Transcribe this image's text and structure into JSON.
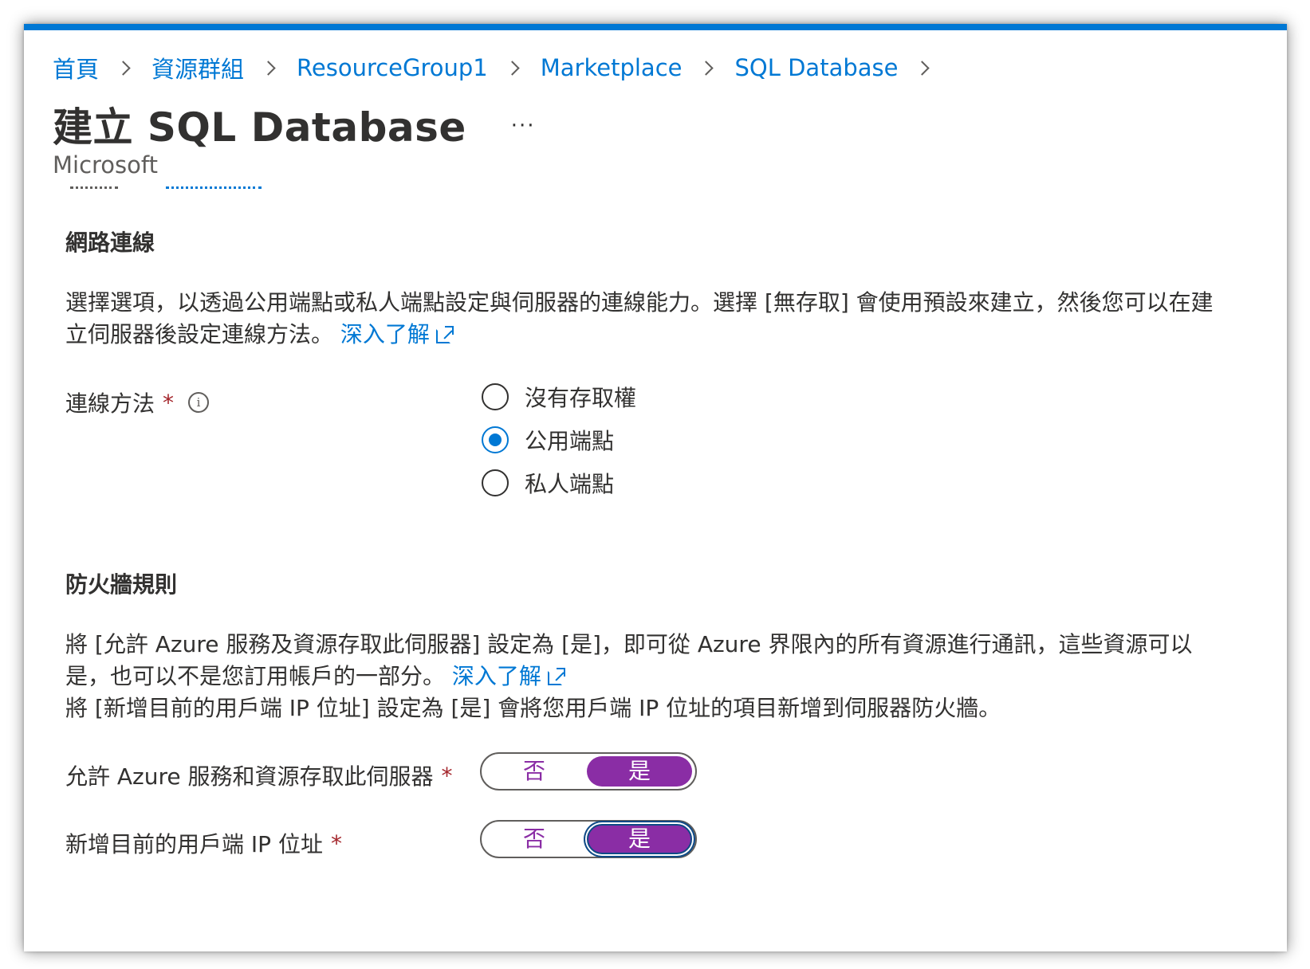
{
  "breadcrumb": {
    "items": [
      "首頁",
      "資源群組",
      "ResourceGroup1",
      "Marketplace",
      "SQL Database"
    ]
  },
  "header": {
    "title": "建立 SQL Database",
    "more_label": "···",
    "subtitle": "Microsoft"
  },
  "network": {
    "section_title": "網路連線",
    "description": "選擇選項，以透過公用端點或私人端點設定與伺服器的連線能力。選擇 [無存取] 會使用預設來建立，然後您可以在建立伺服器後設定連線方法。",
    "learn_more": "深入了解",
    "connection_method": {
      "label": "連線方法",
      "required_mark": "*",
      "info_icon": "i",
      "options": [
        "沒有存取權",
        "公用端點",
        "私人端點"
      ],
      "selected": "公用端點"
    }
  },
  "firewall": {
    "section_title": "防火牆規則",
    "description_1": "將 [允許 Azure 服務及資源存取此伺服器] 設定為 [是]，即可從 Azure 界限內的所有資源進行通訊，這些資源可以是，也可以不是您訂用帳戶的一部分。",
    "learn_more": "深入了解",
    "description_2": "將 [新增目前的用戶端 IP 位址] 設定為 [是] 會將您用戶端 IP 位址的項目新增到伺服器防火牆。",
    "allow_azure": {
      "label": "允許 Azure 服務和資源存取此伺服器",
      "required_mark": "*",
      "no_label": "否",
      "yes_label": "是",
      "value": "是"
    },
    "add_client_ip": {
      "label": "新增目前的用戶端 IP 位址",
      "required_mark": "*",
      "no_label": "否",
      "yes_label": "是",
      "value": "是"
    }
  },
  "colors": {
    "accent": "#0078d4",
    "toggle_selected": "#8a2da5",
    "required": "#a4262c"
  }
}
